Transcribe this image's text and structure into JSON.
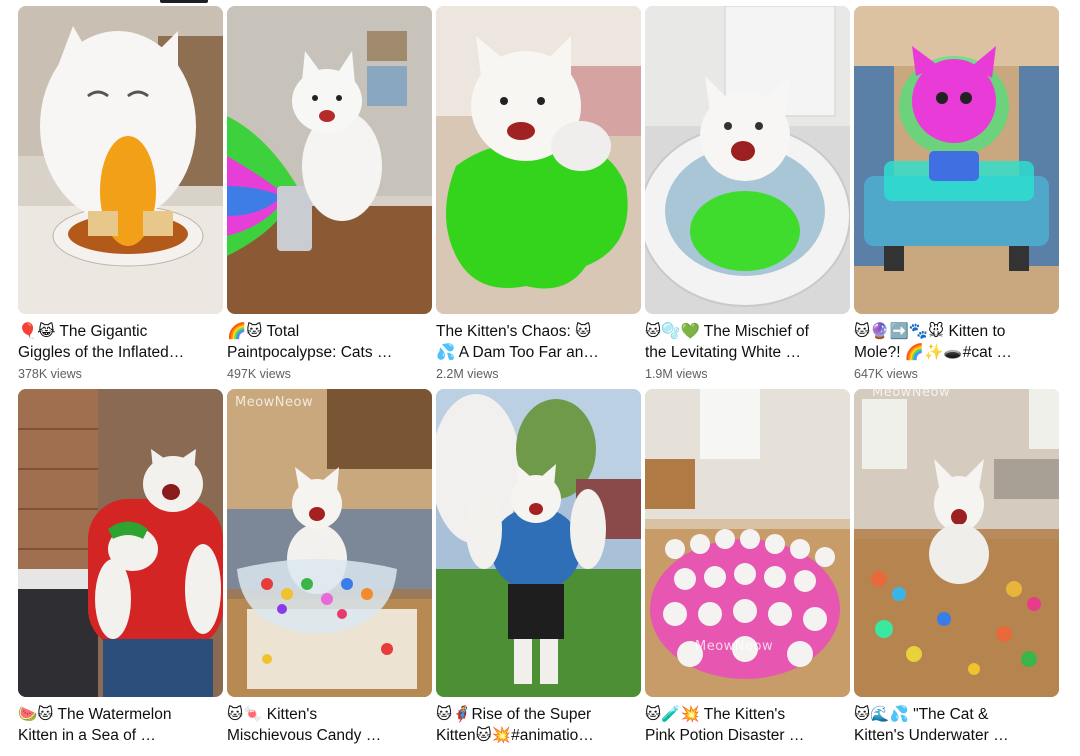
{
  "videos": [
    {
      "title_line1": "🎈😹 The Gigantic",
      "title_line2": "Giggles of the Inflated…",
      "views": "378K views"
    },
    {
      "title_line1": "🌈🐱 Total",
      "title_line2": "Paintpocalypse: Cats …",
      "views": "497K views"
    },
    {
      "title_line1": "The Kitten's Chaos: 🐱",
      "title_line2": "💦 A Dam Too Far an…",
      "views": "2.2M views"
    },
    {
      "title_line1": "🐱🫧💚 The Mischief of",
      "title_line2": "the Levitating White …",
      "views": "1.9M views"
    },
    {
      "title_line1": "🐱🔮➡️🐾🐭 Kitten to",
      "title_line2": "Mole?! 🌈✨🕳️#cat …",
      "views": "647K views"
    },
    {
      "title_line1": "🍉🐱 The Watermelon",
      "title_line2": "Kitten in a Sea of …",
      "views": "",
      "watermark": ""
    },
    {
      "title_line1": "🐱🍬 Kitten's",
      "title_line2": "Mischievous Candy …",
      "views": "",
      "watermark": "MeowNeow"
    },
    {
      "title_line1": "🐱🦸Rise of the Super",
      "title_line2": "Kitten🐱💥#animatio…",
      "views": ""
    },
    {
      "title_line1": "🐱🧪💥 The Kitten's",
      "title_line2": "Pink Potion Disaster …",
      "views": "",
      "watermark": "MeowNeow"
    },
    {
      "title_line1": "🐱🌊💦 \"The Cat &",
      "title_line2": "Kitten's Underwater …",
      "views": "",
      "watermark": "MeowNeow"
    }
  ],
  "colors": {
    "title": "#0f0f0f",
    "views": "#606060",
    "background": "#ffffff"
  }
}
